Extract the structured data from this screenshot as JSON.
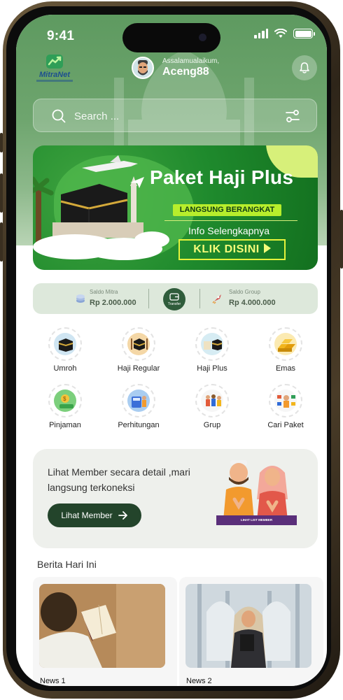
{
  "status_bar": {
    "time": "9:41"
  },
  "header": {
    "logo_text": "MitraNet",
    "greeting": "Assalamualaikum,",
    "username": "Aceng88"
  },
  "search": {
    "placeholder": "Search ..."
  },
  "banner": {
    "title": "Paket Haji Plus",
    "tag": "LANGSUNG BERANGKAT",
    "info": "Info Selengkapnya",
    "cta": "KLIK DISINI"
  },
  "saldo": {
    "mitra_label": "Saldo Mitra",
    "mitra_value": "Rp 2.000.000",
    "transfer_label": "Transfer",
    "group_label": "Saldo Group",
    "group_value": "Rp 4.000.000"
  },
  "categories": [
    {
      "label": "Umroh",
      "icon": "kaaba-icon"
    },
    {
      "label": "Haji Regular",
      "icon": "kaaba-icon"
    },
    {
      "label": "Haji Plus",
      "icon": "kaaba-icon"
    },
    {
      "label": "Emas",
      "icon": "gold-bars-icon"
    },
    {
      "label": "Pinjaman",
      "icon": "money-icon"
    },
    {
      "label": "Perhitungan",
      "icon": "calculator-icon"
    },
    {
      "label": "Grup",
      "icon": "group-icon"
    },
    {
      "label": "Cari Paket",
      "icon": "search-package-icon"
    }
  ],
  "member": {
    "text": "Lihat Member secara detail ,mari langsung terkoneksi",
    "button": "Lihat Member",
    "ribbon": "LIHAT LIST MEMBER"
  },
  "news": {
    "title": "Berita Hari Ini",
    "items": [
      {
        "caption": "News 1"
      },
      {
        "caption": "News 2"
      }
    ]
  },
  "colors": {
    "header_green": "#6ea56e",
    "banner_green": "#1f8a2d",
    "button_dark_green": "#23442b",
    "accent_yellow": "#e5f33c"
  }
}
